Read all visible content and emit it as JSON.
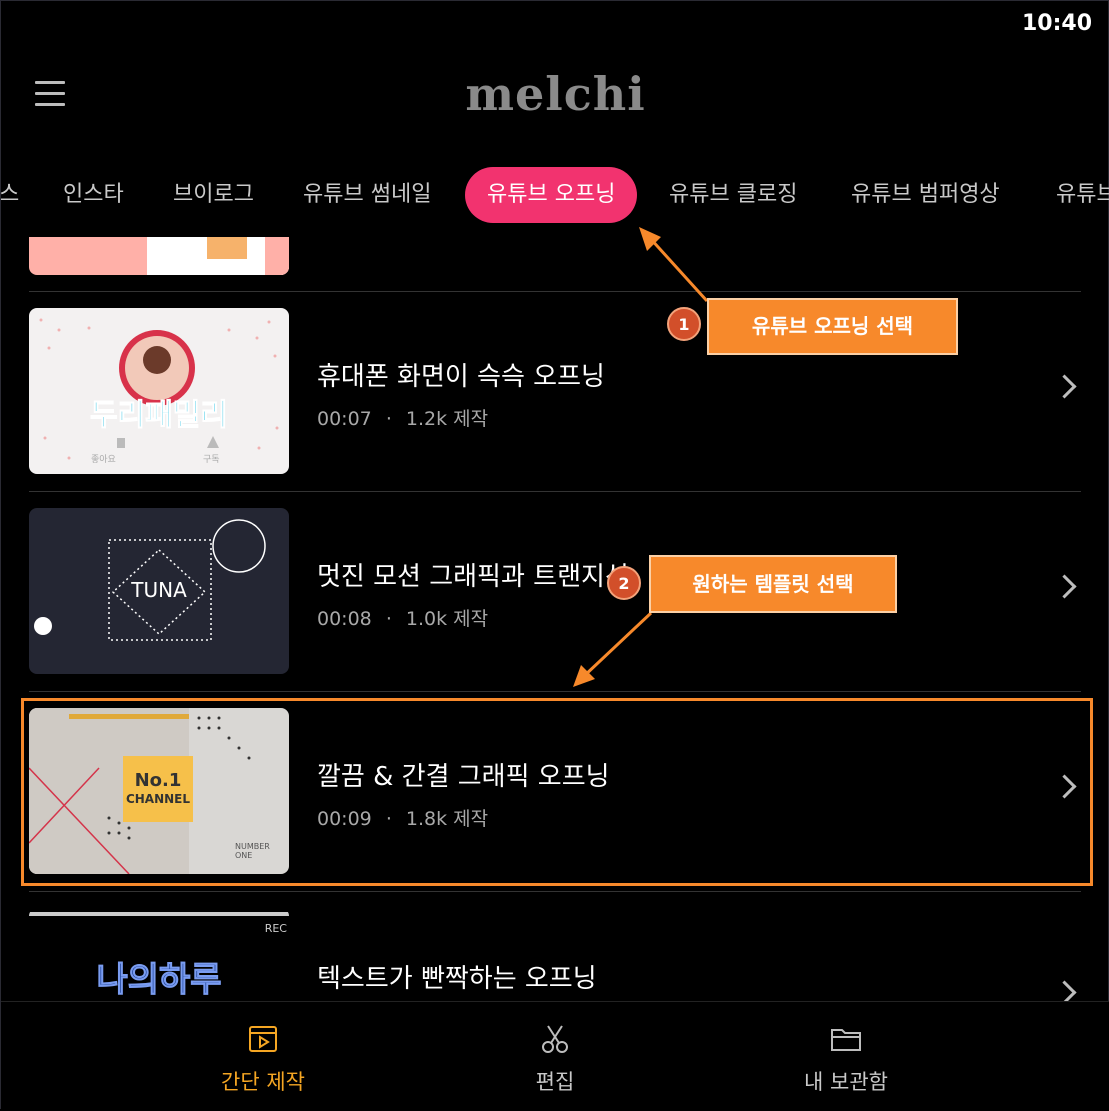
{
  "status": {
    "time": "10:40"
  },
  "header": {
    "logo": "melchi",
    "menu_icon": "menu-icon"
  },
  "tabs": [
    {
      "label": "스"
    },
    {
      "label": "인스타"
    },
    {
      "label": "브이로그"
    },
    {
      "label": "유튜브 썸네일"
    },
    {
      "label": "유튜브 오프닝",
      "active": true
    },
    {
      "label": "유튜브 클로징"
    },
    {
      "label": "유튜브 범퍼영상"
    },
    {
      "label": "유튜브"
    }
  ],
  "items": [
    {
      "title": "휴대폰 화면이 슥슥 오프닝",
      "duration": "00:07",
      "count": "1.2k 제작",
      "thumb_text": "두리패밀리",
      "thumb_like": "좋아요",
      "thumb_sub": "구독"
    },
    {
      "title": "멋진 모션 그래픽과 트랜지션",
      "duration": "00:08",
      "count": "1.0k 제작",
      "thumb_text": "TUNA"
    },
    {
      "title": "깔끔 & 간결 그래픽 오프닝",
      "duration": "00:09",
      "count": "1.8k 제작",
      "thumb_text": "No.1",
      "thumb_sub": "CHANNEL",
      "thumb_small": "NUMBER ONE"
    },
    {
      "title": "텍스트가 빤짝하는 오프닝",
      "thumb_text": "나의하루",
      "thumb_rec": "REC"
    }
  ],
  "separator": "·",
  "callouts": [
    {
      "number": "1",
      "text": "유튜브 오프닝 선택"
    },
    {
      "number": "2",
      "text": "원하는 템플릿 선택"
    }
  ],
  "bottom_nav": [
    {
      "label": "간단 제작",
      "icon": "video-icon",
      "active": true
    },
    {
      "label": "편집",
      "icon": "scissors-icon"
    },
    {
      "label": "내 보관함",
      "icon": "folder-icon"
    }
  ],
  "colors": {
    "accent_pink": "#f2336f",
    "callout_orange": "#f7892b",
    "nav_active": "#f5a623"
  }
}
